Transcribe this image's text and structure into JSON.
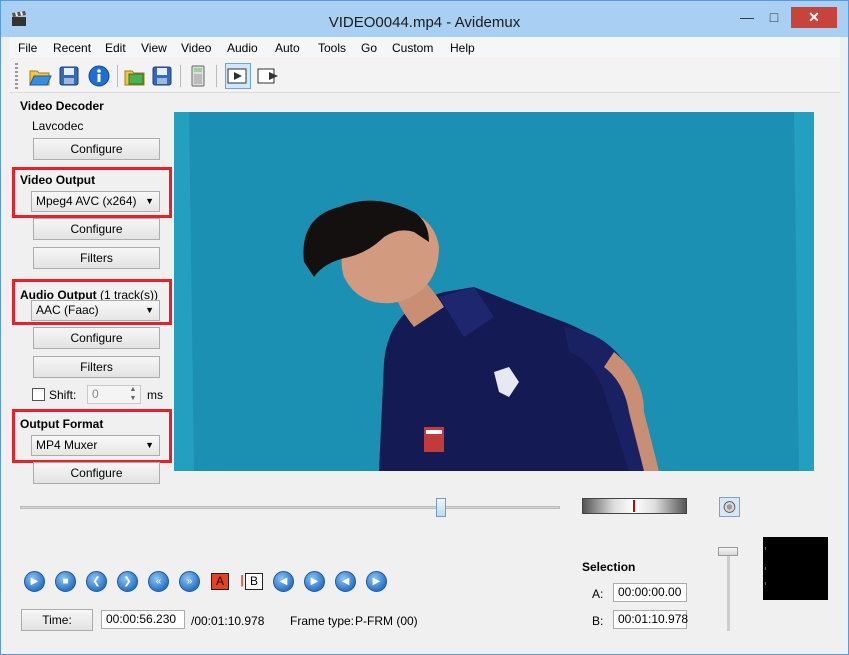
{
  "window": {
    "title": "VIDEO0044.mp4 - Avidemux"
  },
  "menu": [
    "File",
    "Recent",
    "Edit",
    "View",
    "Video",
    "Audio",
    "Auto",
    "Tools",
    "Go",
    "Custom",
    "Help"
  ],
  "toolbar": {
    "icons": [
      "open-icon",
      "save-icon",
      "info-icon",
      "open-image-icon",
      "save-image-icon",
      "calculator-icon",
      "play-filtered-icon",
      "output-preview-icon"
    ]
  },
  "video_decoder": {
    "heading": "Video Decoder",
    "codec": "Lavcodec",
    "configure_label": "Configure"
  },
  "video_output": {
    "heading": "Video Output",
    "selected": "Mpeg4 AVC (x264)",
    "configure_label": "Configure",
    "filters_label": "Filters"
  },
  "audio_output": {
    "heading": "Audio Output",
    "tracks": "(1 track(s))",
    "selected": "AAC (Faac)",
    "configure_label": "Configure",
    "filters_label": "Filters",
    "shift_label": "Shift:",
    "shift_value": "0",
    "shift_unit": "ms"
  },
  "output_format": {
    "heading": "Output Format",
    "selected": "MP4 Muxer",
    "configure_label": "Configure"
  },
  "timeline": {
    "position_fraction": 0.78
  },
  "navigation": {
    "marker_a": "A",
    "marker_b": "B"
  },
  "time": {
    "button_label": "Time:",
    "current": "00:00:56.230",
    "total": "/00:01:10.978",
    "frame_type_label": "Frame type:",
    "frame_type": "P-FRM (00)"
  },
  "selection": {
    "heading": "Selection",
    "a_label": "A:",
    "a_value": "00:00:00.00",
    "b_label": "B:",
    "b_value": "00:01:10.978"
  },
  "colors": {
    "highlight": "#e8202a",
    "accent": "#2a74c7"
  }
}
